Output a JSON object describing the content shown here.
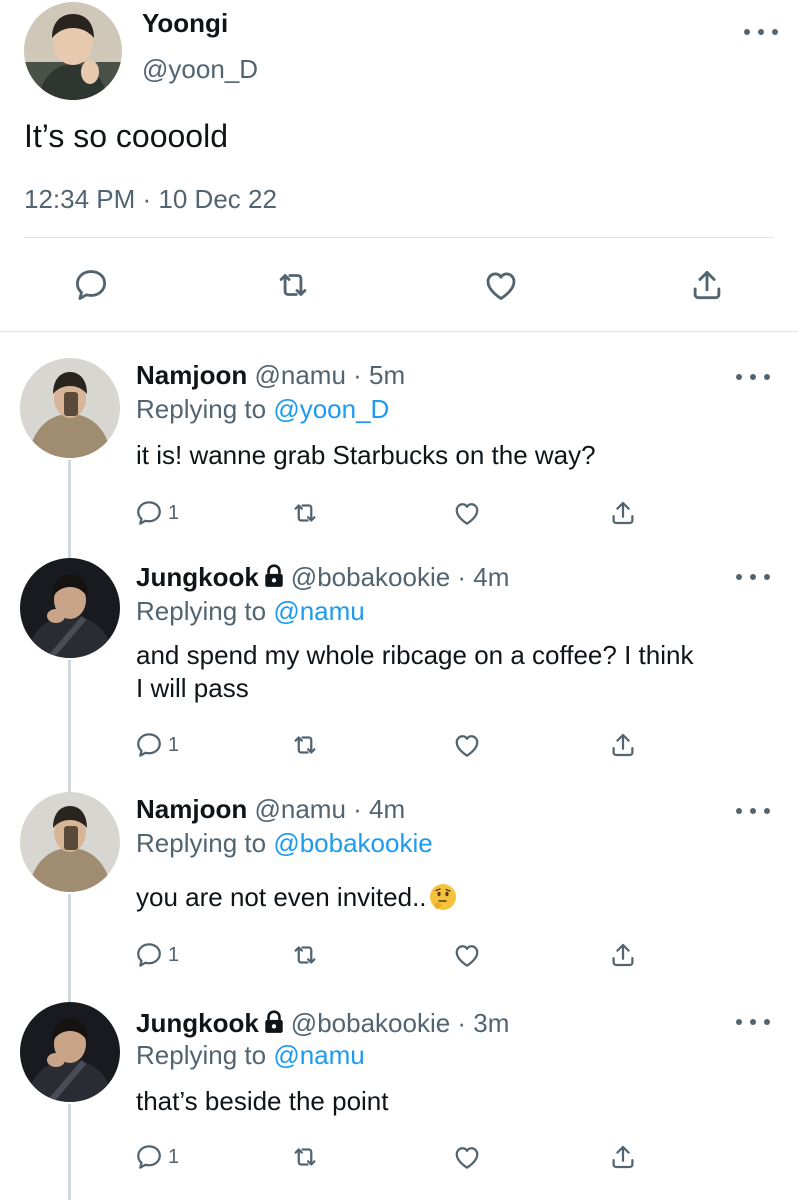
{
  "main_tweet": {
    "display_name": "Yoongi",
    "handle": "@yoon_D",
    "text": "It’s so coooold",
    "timestamp": "12:34 PM · 10 Dec 22"
  },
  "replies": [
    {
      "display_name": "Namjoon",
      "locked": false,
      "meta": "@namu · 5m",
      "replying_prefix": "Replying to",
      "replying_to": "@yoon_D",
      "text_lines": [
        "it is! wanne grab Starbucks on the way?"
      ],
      "reply_count": "1"
    },
    {
      "display_name": "Jungkook",
      "locked": true,
      "meta": "@bobakookie · 4m",
      "replying_prefix": "Replying to",
      "replying_to": "@namu",
      "text_lines": [
        "and spend my whole ribcage on a coffee? I think",
        "I will pass"
      ],
      "reply_count": "1"
    },
    {
      "display_name": "Namjoon",
      "locked": false,
      "meta": "@namu · 4m",
      "replying_prefix": "Replying to",
      "replying_to": "@bobakookie",
      "text_lines": [
        "you are not even invited.."
      ],
      "emoji": "thinking-face-emoji",
      "reply_count": "1"
    },
    {
      "display_name": "Jungkook",
      "locked": true,
      "meta": "@bobakookie · 3m",
      "replying_prefix": "Replying to",
      "replying_to": "@namu",
      "text_lines": [
        "that’s beside the point"
      ],
      "reply_count": "1"
    }
  ],
  "colors": {
    "text": "#0f1419",
    "secondary": "#536471",
    "link": "#1d9bf0",
    "divider": "#dfe3e6",
    "thread_line": "#cfd9de"
  },
  "icons": [
    "more-icon",
    "reply-icon",
    "retweet-icon",
    "like-icon",
    "share-icon",
    "lock-icon"
  ]
}
